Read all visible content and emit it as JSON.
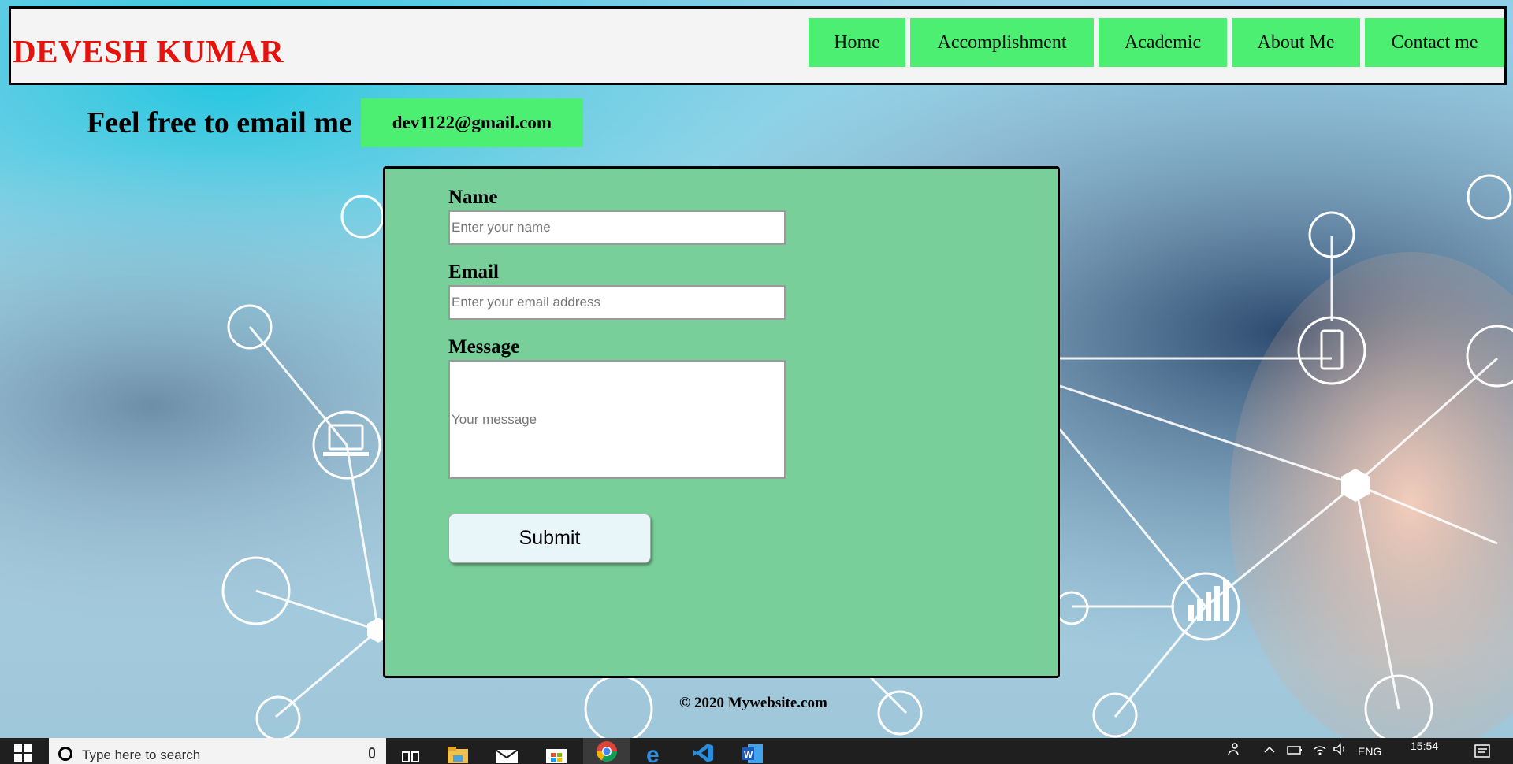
{
  "header": {
    "brand": "DEVESH KUMAR",
    "nav": [
      "Home",
      "Accomplishment",
      "Academic",
      "About Me",
      "Contact me"
    ]
  },
  "contact": {
    "heading": "Feel free to email me",
    "email": "dev1122@gmail.com"
  },
  "form": {
    "name_label": "Name",
    "name_placeholder": "Enter your name",
    "email_label": "Email",
    "email_placeholder": "Enter your email address",
    "message_label": "Message",
    "message_placeholder": "Your message",
    "submit_label": "Submit"
  },
  "footer": {
    "copyright": "© 2020 Mywebsite.com"
  },
  "taskbar": {
    "search_placeholder": "Type here to search",
    "language": "ENG",
    "time": "15:54",
    "apps": [
      "task-view-icon",
      "file-explorer-icon",
      "mail-icon",
      "store-icon",
      "chrome-icon",
      "edge-icon",
      "vscode-icon",
      "word-icon"
    ]
  },
  "colors": {
    "brand": "#e8120c",
    "nav_bg": "#4def72",
    "form_bg": "#78cf99"
  }
}
